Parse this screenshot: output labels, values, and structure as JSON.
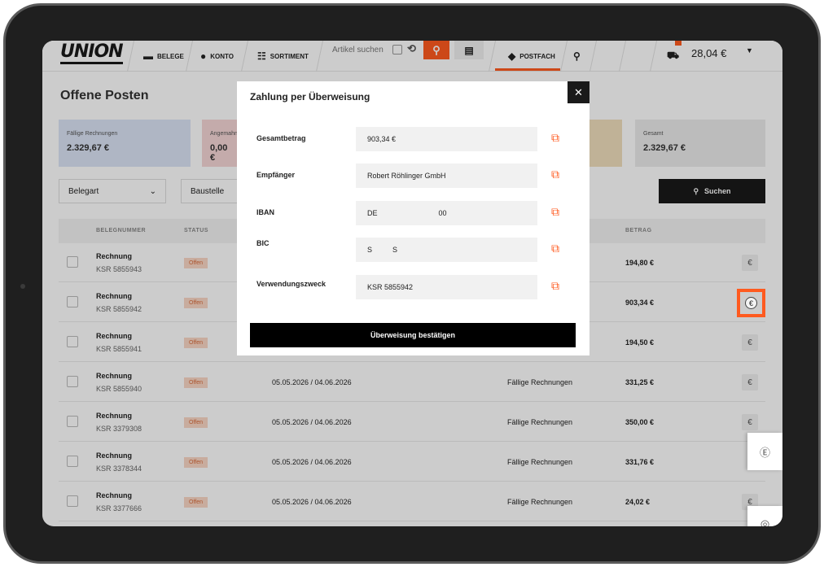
{
  "nav": {
    "logo": "UNION",
    "belege": "BELEGE",
    "konto": "KONTO",
    "sortiment": "SORTIMENT",
    "search_placeholder": "Artikel suchen",
    "postfach": "POSTFACH",
    "cart_price": "28,04 €"
  },
  "page": {
    "title": "Offene Posten",
    "cards": [
      {
        "label": "Fällige Rechnungen",
        "value": "2.329,67 €",
        "color": "#dbe4f5"
      },
      {
        "label": "Angemahnt",
        "value": "0,00 €",
        "color": "#f5d6d6"
      },
      {
        "label": "Gesamt",
        "value": "2.329,67 €",
        "color": "#ececec"
      }
    ],
    "filters": {
      "belegart": "Belegart",
      "baustelle": "Baustelle"
    },
    "search_button": "Suchen",
    "columns": {
      "belegnummer": "BELEGNUMMER",
      "status": "STATUS",
      "betrag": "BETRAG"
    },
    "rows": [
      {
        "type": "Rechnung",
        "number": "KSR 5855943",
        "status": "Offen",
        "dates": "",
        "category": "",
        "amount": "194,80 €"
      },
      {
        "type": "Rechnung",
        "number": "KSR 5855942",
        "status": "Offen",
        "dates": "",
        "category": "",
        "amount": "903,34 €"
      },
      {
        "type": "Rechnung",
        "number": "KSR 5855941",
        "status": "Offen",
        "dates": "",
        "category": "",
        "amount": "194,50 €"
      },
      {
        "type": "Rechnung",
        "number": "KSR 5855940",
        "status": "Offen",
        "dates": "05.05.2026 / 04.06.2026",
        "category": "Fällige Rechnungen",
        "amount": "331,25 €"
      },
      {
        "type": "Rechnung",
        "number": "KSR 3379308",
        "status": "Offen",
        "dates": "05.05.2026 / 04.06.2026",
        "category": "Fällige Rechnungen",
        "amount": "350,00 €"
      },
      {
        "type": "Rechnung",
        "number": "KSR 3378344",
        "status": "Offen",
        "dates": "05.05.2026 / 04.06.2026",
        "category": "Fällige Rechnungen",
        "amount": "331,76 €"
      },
      {
        "type": "Rechnung",
        "number": "KSR 3377666",
        "status": "Offen",
        "dates": "05.05.2026 / 04.06.2026",
        "category": "Fällige Rechnungen",
        "amount": "24,02 €"
      }
    ]
  },
  "modal": {
    "title": "Zahlung per Überweisung",
    "fields": [
      {
        "label": "Gesamtbetrag",
        "value": "903,34 €"
      },
      {
        "label": "Empfänger",
        "value": "Robert Röhlinger GmbH"
      },
      {
        "label": "IBAN",
        "value": "DE                              00"
      },
      {
        "label": "BIC",
        "value": "S          S"
      },
      {
        "label": "Verwendungszweck",
        "value": "KSR 5855942"
      }
    ],
    "confirm": "Überweisung bestätigen"
  },
  "colors": {
    "accent": "#ff5a1f"
  }
}
